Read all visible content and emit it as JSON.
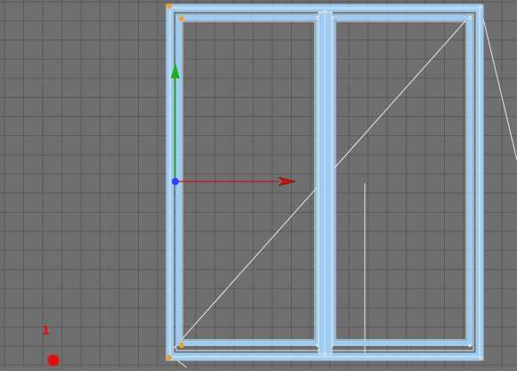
{
  "viewport": {
    "background": "#6f6f6f",
    "grid_color": "#5a5a5a",
    "frame_color": "#9ecbf2",
    "frame_edge_color": "#cfe6fa",
    "wire_color": "#e6e6e6",
    "vertex_color": "#f0a030",
    "gizmo": {
      "y_axis_color": "#1fae1f",
      "x_axis_color": "#c81414",
      "pivot_color": "#3a3aff",
      "y_axis_icon": "arrow-up-icon",
      "x_axis_icon": "arrow-right-icon"
    },
    "marker": {
      "label": "1",
      "color": "#e01010",
      "icon": "dot-icon"
    }
  }
}
